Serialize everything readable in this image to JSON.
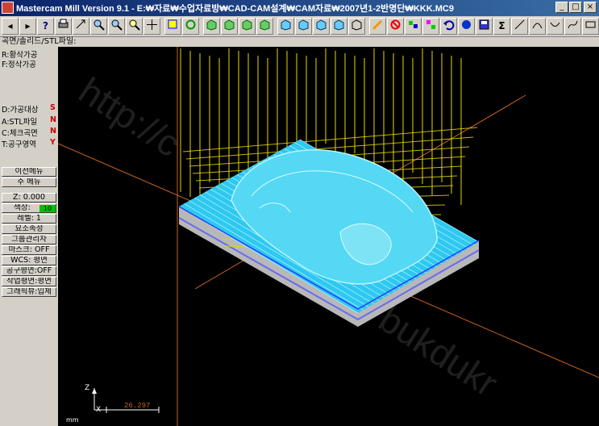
{
  "window": {
    "title": "Mastercam Mill Version 9.1 - E:₩자료₩수업자료방₩CAD-CAM설계₩CAM자료₩2007년1-2반명단₩KKK.MC9",
    "buttons": {
      "minimize": "_",
      "maximize": "□",
      "close": "×"
    }
  },
  "toolbar": {
    "icons": [
      "back-arrow-icon",
      "forward-arrow-icon",
      "help-icon",
      "print-icon",
      "zoom-fit-icon",
      "zoom-in-icon",
      "zoom-out-icon",
      "zoom-window-icon",
      "pan-icon",
      "rotate-icon",
      "view-top-icon",
      "view-front-icon",
      "view-side-icon",
      "view-iso-icon",
      "view-right-icon",
      "view-left-icon",
      "view-bottom-icon",
      "view-back-icon",
      "view-custom-icon",
      "cube-icon",
      "pencil-icon",
      "no-entry-icon",
      "measure-icon",
      "transform-icon",
      "undo-icon",
      "sphere-icon",
      "save-icon",
      "sigma-icon",
      "line-icon",
      "arc-icon",
      "curve-icon",
      "spline-icon",
      "rectangle-icon"
    ]
  },
  "prompt": {
    "text": "곡면/솔리드/STL파일:"
  },
  "menu": {
    "items": [
      {
        "label": "R:황삭가공",
        "flag": ""
      },
      {
        "label": "F:정삭가공",
        "flag": ""
      },
      {
        "label": "D:가공대상",
        "flag": "S"
      },
      {
        "label": "A:STL파일",
        "flag": "N"
      },
      {
        "label": "C:체크곡면",
        "flag": "N"
      },
      {
        "label": "T:공구영역",
        "flag": "Y"
      }
    ],
    "prev_menu": "이전메뉴",
    "main_menu": "주 메뉴"
  },
  "status": {
    "z": "Z:  0.000",
    "color_label": "색상:",
    "color_value": "10",
    "level": "레벨:  1",
    "attributes": "요소속성",
    "group": "그룹관리자",
    "mask": "마스크: OFF",
    "wcs": "WCS: 평면",
    "tool_plane": "공구평면:OFF",
    "construction_plane": "작업평면:평면",
    "graphics_view": "그래픽뷰:입체"
  },
  "viewport": {
    "scale_value": "26.297",
    "axis_x": "X",
    "axis_z": "Z",
    "corner_text": "mm",
    "watermarks": [
      "http://c",
      "bukdukr"
    ],
    "colors": {
      "toolpath": "#e6d800",
      "stock": "#2ec8f0",
      "base": "#c8c8c8",
      "grid": "#c8641e"
    }
  }
}
